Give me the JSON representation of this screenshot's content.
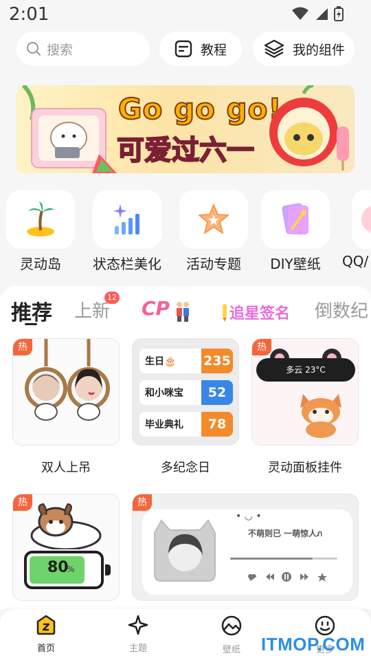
{
  "status_bar": {
    "time": "2:01"
  },
  "top": {
    "search_placeholder": "搜索",
    "tutorial_label": "教程",
    "my_widgets_label": "我的组件"
  },
  "banner": {
    "title_line1": "Go go go!",
    "title_line2": "可爱过六一"
  },
  "quick_items": [
    {
      "label": "灵动岛",
      "icon": "island-icon"
    },
    {
      "label": "状态栏美化",
      "icon": "signal-sparkle-icon"
    },
    {
      "label": "活动专题",
      "icon": "star-icon"
    },
    {
      "label": "DIY壁纸",
      "icon": "wand-card-icon"
    },
    {
      "label": "QQ/",
      "icon": "qq-icon"
    }
  ],
  "tabs": {
    "recommend": "推荐",
    "new": "上新",
    "new_badge": "12",
    "cp": "CP",
    "star_sign": "追星签名",
    "countdown": "倒数纪"
  },
  "cards": {
    "hot_label": "热",
    "c1_title": "双人上吊",
    "c2_title": "多纪念日",
    "c3_title": "灵动面板挂件",
    "countdown_rows": [
      {
        "label": "生日🎂",
        "value": "235",
        "color": "#f58a2b"
      },
      {
        "label": "和小咪宝",
        "value": "52",
        "color": "#3a86e8"
      },
      {
        "label": "毕业典礼",
        "value": "78",
        "color": "#f58a2b"
      }
    ],
    "weather_text": "多云 23°C",
    "battery_value": "80",
    "battery_unit": "%",
    "music_title": "不萌则已 一萌惊人ภ"
  },
  "bottom_nav": [
    {
      "label": "首页",
      "icon": "home-icon",
      "active": true
    },
    {
      "label": "主题",
      "icon": "sparkle-icon",
      "active": false
    },
    {
      "label": "壁纸",
      "icon": "wallpaper-icon",
      "active": false
    },
    {
      "label": "更多",
      "icon": "smile-icon",
      "active": false
    }
  ],
  "watermark": "ITMOP.COM",
  "colors": {
    "hot": "#f5653c",
    "badge": "#ff5b5b",
    "cp": "#f65f9c",
    "orange": "#f58a2b",
    "blue": "#3a86e8"
  }
}
